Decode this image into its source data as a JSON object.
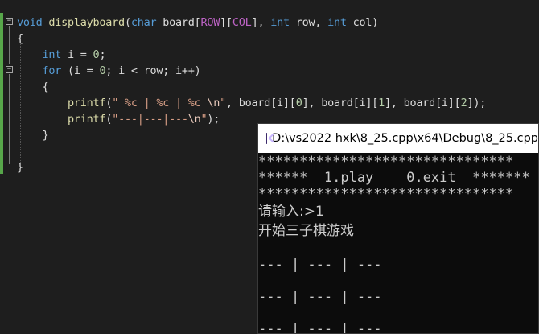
{
  "editor": {
    "lines": [
      {
        "parts": [
          {
            "t": "void",
            "c": "kw"
          },
          {
            "t": " ",
            "c": ""
          },
          {
            "t": "displayboard",
            "c": "fn"
          },
          {
            "t": "(",
            "c": ""
          },
          {
            "t": "char",
            "c": "kw"
          },
          {
            "t": " board[",
            "c": ""
          },
          {
            "t": "ROW",
            "c": "pp"
          },
          {
            "t": "][",
            "c": ""
          },
          {
            "t": "COL",
            "c": "pp"
          },
          {
            "t": "], ",
            "c": ""
          },
          {
            "t": "int",
            "c": "kw"
          },
          {
            "t": " row, ",
            "c": ""
          },
          {
            "t": "int",
            "c": "kw"
          },
          {
            "t": " col)",
            "c": ""
          }
        ]
      },
      {
        "parts": [
          {
            "t": "{",
            "c": ""
          }
        ]
      },
      {
        "parts": [
          {
            "t": "    ",
            "c": ""
          },
          {
            "t": "int",
            "c": "kw"
          },
          {
            "t": " i = ",
            "c": ""
          },
          {
            "t": "0",
            "c": "num"
          },
          {
            "t": ";",
            "c": ""
          }
        ]
      },
      {
        "parts": [
          {
            "t": "    ",
            "c": ""
          },
          {
            "t": "for",
            "c": "kw"
          },
          {
            "t": " (i = ",
            "c": ""
          },
          {
            "t": "0",
            "c": "num"
          },
          {
            "t": "; i < row; i++)",
            "c": ""
          }
        ]
      },
      {
        "parts": [
          {
            "t": "    {",
            "c": ""
          }
        ]
      },
      {
        "parts": [
          {
            "t": "        ",
            "c": ""
          },
          {
            "t": "printf",
            "c": "fn"
          },
          {
            "t": "(",
            "c": ""
          },
          {
            "t": "\" %c | %c | %c ",
            "c": "str"
          },
          {
            "t": "\\n",
            "c": "esc"
          },
          {
            "t": "\"",
            "c": "str"
          },
          {
            "t": ", board[i][",
            "c": ""
          },
          {
            "t": "0",
            "c": "num"
          },
          {
            "t": "], board[i][",
            "c": ""
          },
          {
            "t": "1",
            "c": "num"
          },
          {
            "t": "], board[i][",
            "c": ""
          },
          {
            "t": "2",
            "c": "num"
          },
          {
            "t": "]);",
            "c": ""
          }
        ]
      },
      {
        "parts": [
          {
            "t": "        ",
            "c": ""
          },
          {
            "t": "printf",
            "c": "fn"
          },
          {
            "t": "(",
            "c": ""
          },
          {
            "t": "\"---|---|---",
            "c": "str"
          },
          {
            "t": "\\n",
            "c": "esc"
          },
          {
            "t": "\"",
            "c": "str"
          },
          {
            "t": ");",
            "c": ""
          }
        ]
      },
      {
        "parts": [
          {
            "t": "    }",
            "c": ""
          }
        ]
      },
      {
        "parts": [
          {
            "t": "",
            "c": ""
          }
        ]
      },
      {
        "parts": [
          {
            "t": "}",
            "c": ""
          }
        ]
      }
    ]
  },
  "console": {
    "title": "D:\\vs2022 hxk\\8_25.cpp\\x64\\Debug\\8_25.cpp",
    "lines": [
      "*******************************",
      "******  1.play    0.exit  *******",
      "*******************************",
      "请输入:>1",
      "开始三子棋游戏",
      "",
      "--- | --- | ---",
      "",
      "--- | --- | ---",
      "",
      "--- | --- | ---"
    ]
  },
  "colors": {
    "keyword": "#569cd6",
    "function": "#dcdcaa",
    "macro": "#bd63c5",
    "string": "#d69d85",
    "number": "#b5cea8",
    "changebar": "#57a64a",
    "console_bg": "#0c0c0c"
  }
}
